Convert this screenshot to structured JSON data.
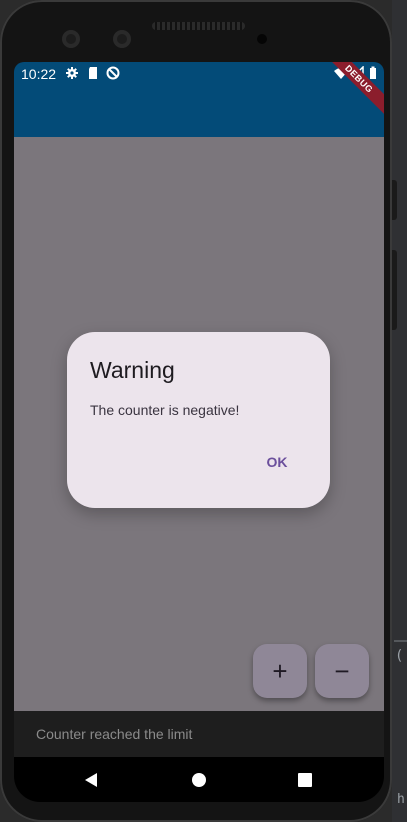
{
  "status_bar": {
    "time": "10:22",
    "left_icons": [
      "settings-icon",
      "sd-card-icon",
      "do-not-disturb-icon"
    ],
    "right_icons": [
      "wifi-icon",
      "signal-icon",
      "battery-icon"
    ]
  },
  "debug_banner": {
    "label": "DEBUG"
  },
  "dialog": {
    "title": "Warning",
    "message": "The counter is negative!",
    "ok_label": "OK"
  },
  "fabs": {
    "increment_label": "+",
    "decrement_label": "−"
  },
  "snackbar": {
    "message": "Counter reached the limit"
  },
  "nav_bar": {
    "buttons": [
      "back-icon",
      "home-icon",
      "recents-icon"
    ]
  },
  "colors": {
    "app_bar": "#034b78",
    "scrim_background": "#7b767c",
    "dialog_surface": "#ece4ec",
    "accent": "#6b4f9c",
    "fab": "#8f8797"
  }
}
